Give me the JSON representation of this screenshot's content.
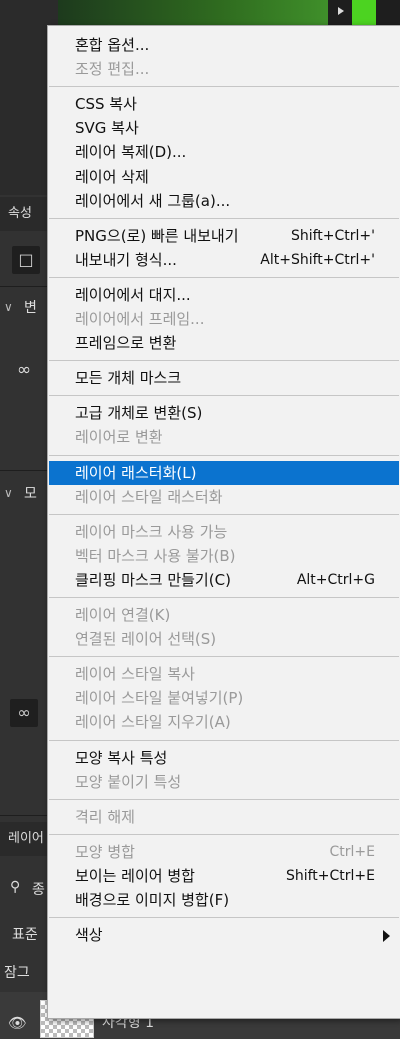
{
  "background": {
    "panel_tabs": {
      "properties": "속성",
      "layers": "레이어"
    },
    "section_1_label": "변",
    "section_2_label": "모",
    "search_label": "종",
    "blend_mode_label": "표준",
    "lock_label": "잠그",
    "layer_name": "사각형 1"
  },
  "menu": {
    "groups": [
      [
        {
          "label": "혼합 옵션...",
          "disabled": false
        },
        {
          "label": "조정 편집...",
          "disabled": true
        }
      ],
      [
        {
          "label": "CSS 복사",
          "disabled": false
        },
        {
          "label": "SVG 복사",
          "disabled": false
        },
        {
          "label": "레이어 복제(D)...",
          "disabled": false
        },
        {
          "label": "레이어 삭제",
          "disabled": false
        },
        {
          "label": "레이어에서 새 그룹(a)...",
          "disabled": false
        }
      ],
      [
        {
          "label": "PNG으(로) 빠른 내보내기",
          "shortcut": "Shift+Ctrl+'",
          "disabled": false
        },
        {
          "label": "내보내기 형식...",
          "shortcut": "Alt+Shift+Ctrl+'",
          "disabled": false
        }
      ],
      [
        {
          "label": "레이어에서 대지...",
          "disabled": false
        },
        {
          "label": "레이어에서 프레임...",
          "disabled": true
        },
        {
          "label": "프레임으로 변환",
          "disabled": false
        }
      ],
      [
        {
          "label": "모든 개체 마스크",
          "disabled": false
        }
      ],
      [
        {
          "label": "고급 개체로 변환(S)",
          "disabled": false
        },
        {
          "label": "레이어로 변환",
          "disabled": true
        }
      ],
      [
        {
          "label": "레이어 래스터화(L)",
          "disabled": false,
          "highlighted": true
        },
        {
          "label": "레이어 스타일 래스터화",
          "disabled": true
        }
      ],
      [
        {
          "label": "레이어 마스크 사용 가능",
          "disabled": true
        },
        {
          "label": "벡터 마스크 사용 불가(B)",
          "disabled": true
        },
        {
          "label": "클리핑 마스크 만들기(C)",
          "shortcut": "Alt+Ctrl+G",
          "disabled": false
        }
      ],
      [
        {
          "label": "레이어 연결(K)",
          "disabled": true
        },
        {
          "label": "연결된 레이어 선택(S)",
          "disabled": true
        }
      ],
      [
        {
          "label": "레이어 스타일 복사",
          "disabled": true
        },
        {
          "label": "레이어 스타일 붙여넣기(P)",
          "disabled": true
        },
        {
          "label": "레이어 스타일 지우기(A)",
          "disabled": true
        }
      ],
      [
        {
          "label": "모양 복사 특성",
          "disabled": false
        },
        {
          "label": "모양 붙이기 특성",
          "disabled": true
        }
      ],
      [
        {
          "label": "격리 해제",
          "disabled": true
        }
      ],
      [
        {
          "label": "모양 병합",
          "shortcut": "Ctrl+E",
          "disabled": true
        },
        {
          "label": "보이는 레이어 병합",
          "shortcut": "Shift+Ctrl+E",
          "disabled": false
        },
        {
          "label": "배경으로 이미지 병합(F)",
          "disabled": false
        }
      ],
      [
        {
          "label": "색상",
          "disabled": false,
          "submenu": true
        }
      ]
    ]
  },
  "colors": {
    "highlight": "#0b73cf",
    "menu_bg": "#f2f2f2",
    "disabled_text": "#9a9a9a",
    "canvas_green": "#4cd321"
  }
}
